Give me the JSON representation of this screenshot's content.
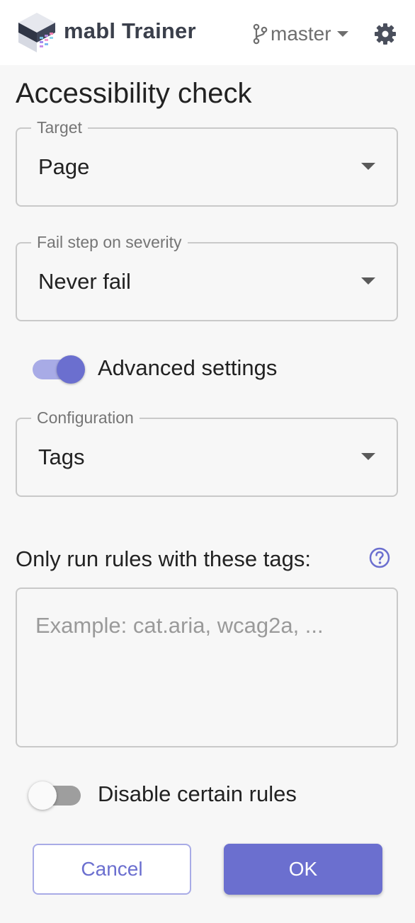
{
  "header": {
    "app_title": "mabl Trainer",
    "branch_name": "master",
    "logo_icon": "mabl-logo-icon",
    "branch_icon": "git-branch-icon",
    "settings_icon": "gear-icon"
  },
  "page": {
    "title": "Accessibility check"
  },
  "target_field": {
    "label": "Target",
    "value": "Page"
  },
  "severity_field": {
    "label": "Fail step on severity",
    "value": "Never fail"
  },
  "advanced_toggle": {
    "label": "Advanced settings",
    "on": true
  },
  "configuration_field": {
    "label": "Configuration",
    "value": "Tags"
  },
  "tags": {
    "label": "Only run rules with these tags:",
    "help_icon": "question-circle-icon",
    "placeholder": "Example: cat.aria, wcag2a, ...",
    "value": ""
  },
  "disable_rules_toggle": {
    "label": "Disable certain rules",
    "on": false
  },
  "actions": {
    "cancel_label": "Cancel",
    "ok_label": "OK"
  },
  "colors": {
    "accent": "#6b6fcf",
    "accent_light": "#a8abe6",
    "border": "#c9c9c9",
    "background": "#f7f7f7"
  }
}
